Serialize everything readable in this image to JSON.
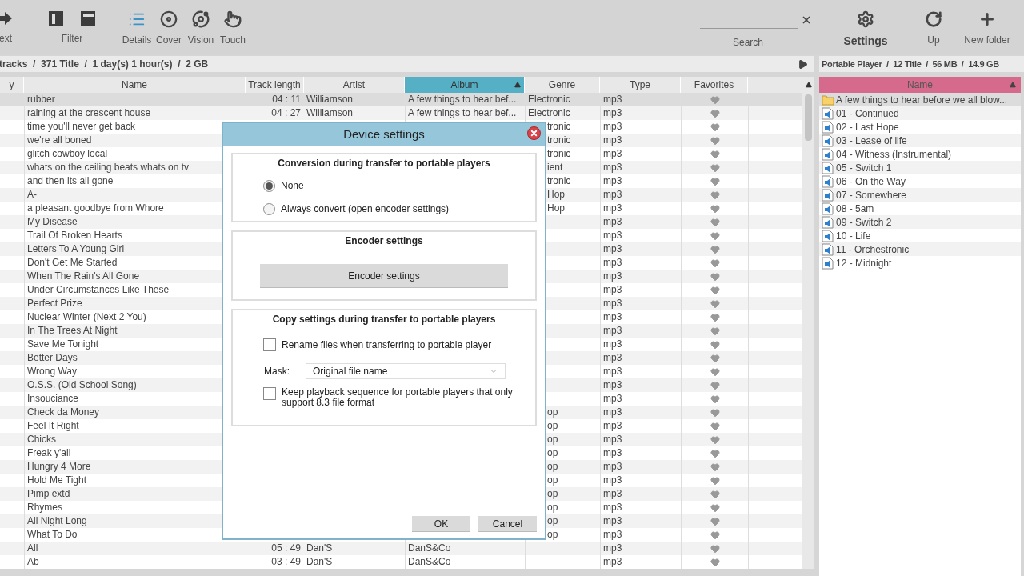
{
  "toolbar": {
    "back": {
      "label": "ext"
    },
    "filter": {
      "label": "Filter"
    },
    "views": [
      {
        "label": "Details",
        "selected": true
      },
      {
        "label": "Cover",
        "selected": false
      },
      {
        "label": "Vision",
        "selected": false
      },
      {
        "label": "Touch",
        "selected": false
      }
    ],
    "search": {
      "label": "Search"
    },
    "settings": {
      "label": "Settings"
    },
    "up": {
      "label": "Up"
    },
    "new_folder": {
      "label": "New folder"
    }
  },
  "library_status": "tracks  /  371 Title  /  1 day(s) 1 hour(s)  /  2 GB",
  "device_status": "Portable Player  /  12 Title  /  56 MB  /  14.9 GB",
  "table": {
    "columns": [
      {
        "label": "y",
        "selected": false
      },
      {
        "label": "Name",
        "selected": false
      },
      {
        "label": "Track length",
        "selected": false
      },
      {
        "label": "Artist",
        "selected": false
      },
      {
        "label": "Album",
        "selected": true
      },
      {
        "label": "Genre",
        "selected": false
      },
      {
        "label": "Type",
        "selected": false
      },
      {
        "label": "Favorites",
        "selected": false
      }
    ],
    "rows": [
      {
        "name": "rubber",
        "length": "04 : 11",
        "artist": "Williamson",
        "album": "A few things to hear bef...",
        "genre": "Electronic",
        "type": "mp3",
        "selected": true
      },
      {
        "name": "raining at the crescent house",
        "length": "04 : 27",
        "artist": "Williamson",
        "album": "A few things to hear bef...",
        "genre": "Electronic",
        "type": "mp3",
        "selected": false
      },
      {
        "name": "time you'll never get back",
        "genre": "tronic",
        "type": "mp3",
        "selected": false
      },
      {
        "name": "we're all boned",
        "genre": "tronic",
        "type": "mp3",
        "selected": false
      },
      {
        "name": "glitch cowboy local",
        "genre": "tronic",
        "type": "mp3",
        "selected": false
      },
      {
        "name": "whats on the ceiling beats whats on tv",
        "genre": "ient",
        "type": "mp3",
        "selected": false
      },
      {
        "name": "and then its all gone",
        "genre": "tronic",
        "type": "mp3",
        "selected": false
      },
      {
        "name": "A-",
        "genre": "Hop",
        "type": "mp3",
        "selected": false
      },
      {
        "name": "a pleasant goodbye from Whore",
        "genre": "Hop",
        "type": "mp3",
        "selected": false
      },
      {
        "name": "My Disease",
        "type": "mp3",
        "selected": false
      },
      {
        "name": "Trail Of Broken Hearts",
        "type": "mp3",
        "selected": false
      },
      {
        "name": "Letters To A Young Girl",
        "type": "mp3",
        "selected": false
      },
      {
        "name": "Don't Get Me Started",
        "type": "mp3",
        "selected": false
      },
      {
        "name": "When The Rain's All Gone",
        "type": "mp3",
        "selected": false
      },
      {
        "name": "Under Circumstances Like These",
        "type": "mp3",
        "selected": false
      },
      {
        "name": "Perfect Prize",
        "type": "mp3",
        "selected": false
      },
      {
        "name": "Nuclear Winter (Next 2 You)",
        "type": "mp3",
        "selected": false
      },
      {
        "name": "In The Trees At Night",
        "type": "mp3",
        "selected": false
      },
      {
        "name": "Save Me Tonight",
        "type": "mp3",
        "selected": false
      },
      {
        "name": "Better Days",
        "type": "mp3",
        "selected": false
      },
      {
        "name": "Wrong Way",
        "type": "mp3",
        "selected": false
      },
      {
        "name": "O.S.S. (Old School Song)",
        "type": "mp3",
        "selected": false
      },
      {
        "name": "Insouciance",
        "type": "mp3",
        "selected": false
      },
      {
        "name": "Check da Money",
        "genre": "op",
        "type": "mp3",
        "selected": false
      },
      {
        "name": "Feel It Right",
        "genre": "op",
        "type": "mp3",
        "selected": false
      },
      {
        "name": "Chicks",
        "genre": "op",
        "type": "mp3",
        "selected": false
      },
      {
        "name": "Freak y'all",
        "genre": "op",
        "type": "mp3",
        "selected": false
      },
      {
        "name": "Hungry 4 More",
        "genre": "op",
        "type": "mp3",
        "selected": false
      },
      {
        "name": "Hold Me Tight",
        "genre": "op",
        "type": "mp3",
        "selected": false
      },
      {
        "name": "Pimp extd",
        "genre": "op",
        "type": "mp3",
        "selected": false
      },
      {
        "name": "Rhymes",
        "genre": "op",
        "type": "mp3",
        "selected": false
      },
      {
        "name": "All Night Long",
        "genre": "op",
        "type": "mp3",
        "selected": false
      },
      {
        "name": "What To Do",
        "genre": "op",
        "type": "mp3",
        "selected": false
      },
      {
        "name": "All",
        "length": "05 : 49",
        "artist": "Dan'S",
        "album": "DanS&Co",
        "type": "mp3",
        "selected": false
      },
      {
        "name": "Ab",
        "length": "03 : 49",
        "artist": "Dan'S",
        "album": "DanS&Co",
        "type": "mp3",
        "selected": false
      }
    ]
  },
  "device": {
    "header": "Name",
    "items": [
      {
        "kind": "folder",
        "name": "A few things to hear before we all blow...",
        "selected": true
      },
      {
        "kind": "file",
        "name": "01 - Continued",
        "selected": false
      },
      {
        "kind": "file",
        "name": "02 - Last Hope",
        "selected": false
      },
      {
        "kind": "file",
        "name": "03 - Lease of life",
        "selected": false
      },
      {
        "kind": "file",
        "name": "04 - Witness (Instrumental)",
        "selected": false
      },
      {
        "kind": "file",
        "name": "05 - Switch 1",
        "selected": false
      },
      {
        "kind": "file",
        "name": "06 - On the Way",
        "selected": false
      },
      {
        "kind": "file",
        "name": "07 - Somewhere",
        "selected": false
      },
      {
        "kind": "file",
        "name": "08 - 5am",
        "selected": false
      },
      {
        "kind": "file",
        "name": "09 - Switch 2",
        "selected": false
      },
      {
        "kind": "file",
        "name": "10 - Life",
        "selected": false
      },
      {
        "kind": "file",
        "name": "11 - Orchestronic",
        "selected": false
      },
      {
        "kind": "file",
        "name": "12 - Midnight",
        "selected": false
      }
    ]
  },
  "dialog": {
    "title": "Device settings",
    "conversion": {
      "title": "Conversion during transfer to portable players",
      "options": [
        {
          "label": "None",
          "selected": true
        },
        {
          "label": "Always convert (open encoder settings)",
          "selected": false
        }
      ]
    },
    "encoder": {
      "title": "Encoder settings",
      "button": "Encoder settings"
    },
    "copy": {
      "title": "Copy settings during transfer to portable players",
      "rename": {
        "label": "Rename files when transferring to portable player",
        "checked": false
      },
      "mask": {
        "label": "Mask:",
        "value": "Original file name"
      },
      "sequence": {
        "label": "Keep playback sequence for portable players that only support 8.3 file format",
        "checked": false
      }
    },
    "buttons": [
      "OK",
      "Cancel"
    ]
  }
}
